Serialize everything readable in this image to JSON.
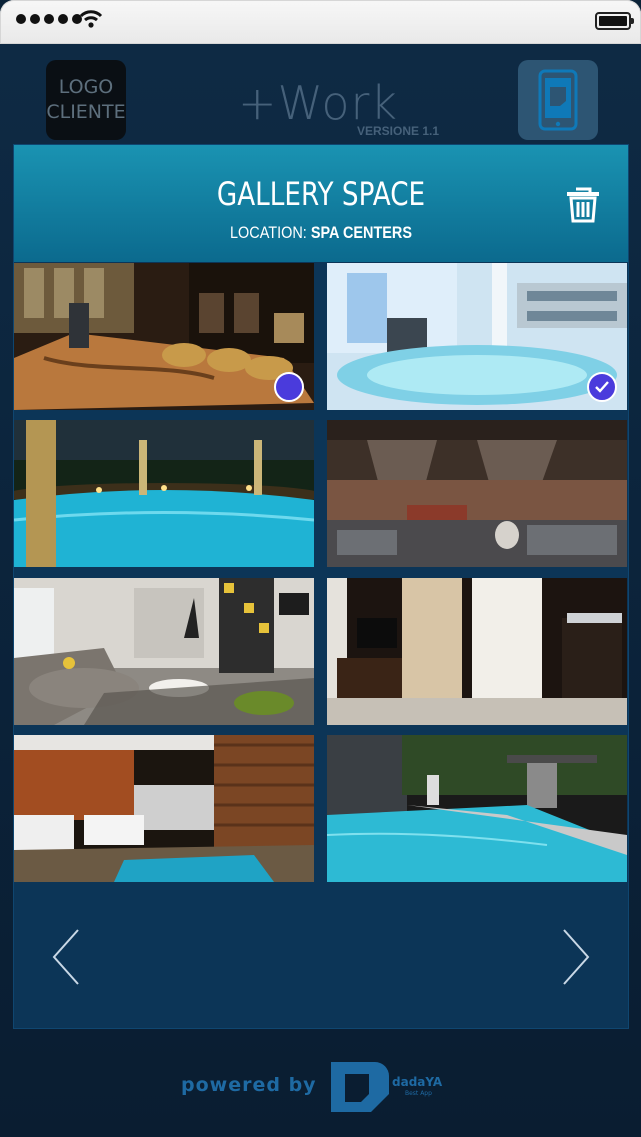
{
  "status_bar": {
    "signal_icon": "signal-dots-icon",
    "wifi_icon": "wifi-icon",
    "battery_icon": "battery-icon"
  },
  "header": {
    "logo_cliente": "LOGO\nCLIENTE",
    "brand": "+Work",
    "version": "VERSIONE 1.1",
    "app_icon": "phone-app-icon"
  },
  "modal": {
    "title": "GALLERY SPACE",
    "location_label": "LOCATION:",
    "location_value": "SPA CENTERS",
    "delete_icon": "trash-icon"
  },
  "gallery": {
    "images": [
      {
        "subject": "wooden table lounge",
        "selected": true,
        "style": "filled"
      },
      {
        "subject": "indoor spa pool",
        "selected": true,
        "style": "check"
      },
      {
        "subject": "night pool with columns",
        "selected": false
      },
      {
        "subject": "modern lounge hall",
        "selected": false
      },
      {
        "subject": "living room with fireplace",
        "selected": false
      },
      {
        "subject": "hotel room with tv",
        "selected": false
      },
      {
        "subject": "pool deck with sofas",
        "selected": false
      },
      {
        "subject": "outdoor pool",
        "selected": false
      }
    ]
  },
  "navigation": {
    "prev_icon": "chevron-left-icon",
    "next_icon": "chevron-right-icon"
  },
  "footer": {
    "powered_by": "powered by",
    "company": "dadaYA",
    "company_sub": "Best App"
  },
  "colors": {
    "header_teal": "#1a93b2",
    "modal_bg": "#0c3557",
    "select_badge": "#4a3bdc"
  }
}
